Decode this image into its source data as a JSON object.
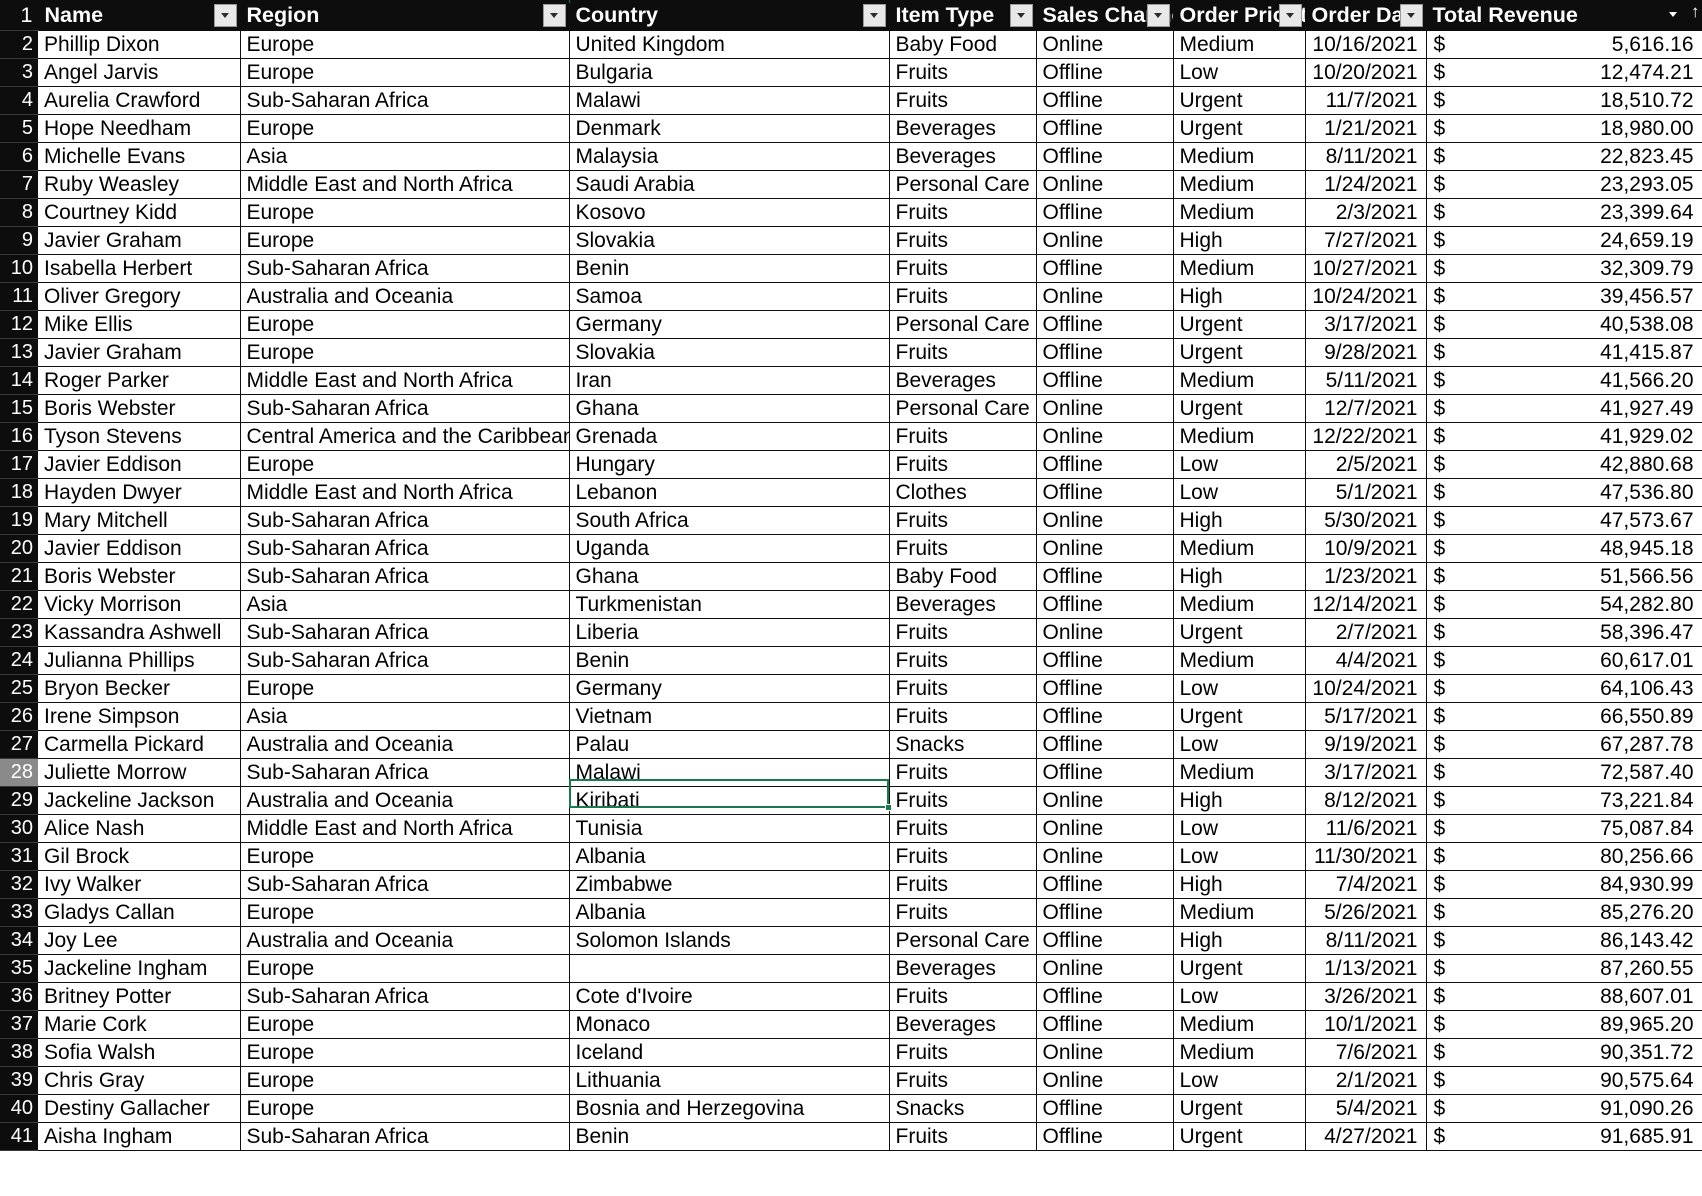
{
  "app": {
    "type": "spreadsheet",
    "accent_color": "#1b7a4b",
    "header_bg": "#0d0d0d",
    "header_fg": "#ffffff",
    "rowheader_selected_bg": "#8a8a8a"
  },
  "columns": [
    {
      "key": "name",
      "label": "Name",
      "filter_icon": "chevron-down-icon",
      "sorted": false,
      "align": "left"
    },
    {
      "key": "region",
      "label": "Region",
      "filter_icon": "chevron-down-icon",
      "sorted": false,
      "align": "left"
    },
    {
      "key": "country",
      "label": "Country",
      "filter_icon": "chevron-down-icon",
      "sorted": false,
      "align": "left"
    },
    {
      "key": "item",
      "label": "Item Type",
      "filter_icon": "chevron-down-icon",
      "sorted": false,
      "align": "left"
    },
    {
      "key": "channel",
      "label": "Sales Channe",
      "filter_icon": "chevron-down-icon",
      "sorted": false,
      "align": "left"
    },
    {
      "key": "prio",
      "label": "Order Priorit",
      "filter_icon": "chevron-down-icon",
      "sorted": false,
      "align": "left"
    },
    {
      "key": "date",
      "label": "Order Dat",
      "filter_icon": "chevron-down-icon",
      "sorted": false,
      "align": "left"
    },
    {
      "key": "revenue",
      "label": "Total Revenue",
      "filter_icon": "chevron-down-icon",
      "sorted": true,
      "sort_direction": "ascending",
      "sort_glyph": "↑",
      "align": "right"
    }
  ],
  "header_row_number": "1",
  "selection": {
    "row_number": "28",
    "column": "Country",
    "value": "Malawi"
  },
  "currency_symbol": "$",
  "rows": [
    {
      "n": "2",
      "name": "Phillip Dixon",
      "region": "Europe",
      "country": "United Kingdom",
      "item": "Baby Food",
      "channel": "Online",
      "prio": "Medium",
      "date": "10/16/2021",
      "revenue": "5,616.16"
    },
    {
      "n": "3",
      "name": "Angel Jarvis",
      "region": "Europe",
      "country": "Bulgaria",
      "item": "Fruits",
      "channel": "Offline",
      "prio": "Low",
      "date": "10/20/2021",
      "revenue": "12,474.21"
    },
    {
      "n": "4",
      "name": "Aurelia Crawford",
      "region": "Sub-Saharan Africa",
      "country": "Malawi",
      "item": "Fruits",
      "channel": "Offline",
      "prio": "Urgent",
      "date": "11/7/2021",
      "revenue": "18,510.72"
    },
    {
      "n": "5",
      "name": "Hope Needham",
      "region": "Europe",
      "country": "Denmark",
      "item": "Beverages",
      "channel": "Offline",
      "prio": "Urgent",
      "date": "1/21/2021",
      "revenue": "18,980.00"
    },
    {
      "n": "6",
      "name": "Michelle Evans",
      "region": "Asia",
      "country": "Malaysia",
      "item": "Beverages",
      "channel": "Offline",
      "prio": "Medium",
      "date": "8/11/2021",
      "revenue": "22,823.45"
    },
    {
      "n": "7",
      "name": "Ruby Weasley",
      "region": "Middle East and North Africa",
      "country": "Saudi Arabia",
      "item": "Personal Care",
      "channel": "Online",
      "prio": "Medium",
      "date": "1/24/2021",
      "revenue": "23,293.05"
    },
    {
      "n": "8",
      "name": "Courtney Kidd",
      "region": "Europe",
      "country": "Kosovo",
      "item": "Fruits",
      "channel": "Offline",
      "prio": "Medium",
      "date": "2/3/2021",
      "revenue": "23,399.64"
    },
    {
      "n": "9",
      "name": "Javier Graham",
      "region": "Europe",
      "country": "Slovakia",
      "item": "Fruits",
      "channel": "Online",
      "prio": "High",
      "date": "7/27/2021",
      "revenue": "24,659.19"
    },
    {
      "n": "10",
      "name": "Isabella Herbert",
      "region": "Sub-Saharan Africa",
      "country": "Benin",
      "item": "Fruits",
      "channel": "Offline",
      "prio": "Medium",
      "date": "10/27/2021",
      "revenue": "32,309.79"
    },
    {
      "n": "11",
      "name": "Oliver Gregory",
      "region": "Australia and Oceania",
      "country": "Samoa",
      "item": "Fruits",
      "channel": "Online",
      "prio": "High",
      "date": "10/24/2021",
      "revenue": "39,456.57"
    },
    {
      "n": "12",
      "name": "Mike Ellis",
      "region": "Europe",
      "country": "Germany",
      "item": "Personal Care",
      "channel": "Offline",
      "prio": "Urgent",
      "date": "3/17/2021",
      "revenue": "40,538.08"
    },
    {
      "n": "13",
      "name": "Javier Graham",
      "region": "Europe",
      "country": "Slovakia",
      "item": "Fruits",
      "channel": "Offline",
      "prio": "Urgent",
      "date": "9/28/2021",
      "revenue": "41,415.87"
    },
    {
      "n": "14",
      "name": "Roger Parker",
      "region": "Middle East and North Africa",
      "country": "Iran",
      "item": "Beverages",
      "channel": "Offline",
      "prio": "Medium",
      "date": "5/11/2021",
      "revenue": "41,566.20"
    },
    {
      "n": "15",
      "name": "Boris Webster",
      "region": "Sub-Saharan Africa",
      "country": "Ghana",
      "item": "Personal Care",
      "channel": "Online",
      "prio": "Urgent",
      "date": "12/7/2021",
      "revenue": "41,927.49"
    },
    {
      "n": "16",
      "name": "Tyson Stevens",
      "region": "Central America and the Caribbean",
      "country": "Grenada",
      "item": "Fruits",
      "channel": "Online",
      "prio": "Medium",
      "date": "12/22/2021",
      "revenue": "41,929.02"
    },
    {
      "n": "17",
      "name": "Javier Eddison",
      "region": "Europe",
      "country": "Hungary",
      "item": "Fruits",
      "channel": "Offline",
      "prio": "Low",
      "date": "2/5/2021",
      "revenue": "42,880.68"
    },
    {
      "n": "18",
      "name": "Hayden Dwyer",
      "region": "Middle East and North Africa",
      "country": "Lebanon",
      "item": "Clothes",
      "channel": "Offline",
      "prio": "Low",
      "date": "5/1/2021",
      "revenue": "47,536.80"
    },
    {
      "n": "19",
      "name": "Mary Mitchell",
      "region": "Sub-Saharan Africa",
      "country": "South Africa",
      "item": "Fruits",
      "channel": "Online",
      "prio": "High",
      "date": "5/30/2021",
      "revenue": "47,573.67"
    },
    {
      "n": "20",
      "name": "Javier Eddison",
      "region": "Sub-Saharan Africa",
      "country": "Uganda",
      "item": "Fruits",
      "channel": "Online",
      "prio": "Medium",
      "date": "10/9/2021",
      "revenue": "48,945.18"
    },
    {
      "n": "21",
      "name": "Boris Webster",
      "region": "Sub-Saharan Africa",
      "country": "Ghana",
      "item": "Baby Food",
      "channel": "Offline",
      "prio": "High",
      "date": "1/23/2021",
      "revenue": "51,566.56"
    },
    {
      "n": "22",
      "name": "Vicky Morrison",
      "region": "Asia",
      "country": "Turkmenistan",
      "item": "Beverages",
      "channel": "Offline",
      "prio": "Medium",
      "date": "12/14/2021",
      "revenue": "54,282.80"
    },
    {
      "n": "23",
      "name": "Kassandra Ashwell",
      "region": "Sub-Saharan Africa",
      "country": "Liberia",
      "item": "Fruits",
      "channel": "Online",
      "prio": "Urgent",
      "date": "2/7/2021",
      "revenue": "58,396.47"
    },
    {
      "n": "24",
      "name": "Julianna Phillips",
      "region": "Sub-Saharan Africa",
      "country": "Benin",
      "item": "Fruits",
      "channel": "Offline",
      "prio": "Medium",
      "date": "4/4/2021",
      "revenue": "60,617.01"
    },
    {
      "n": "25",
      "name": "Bryon Becker",
      "region": "Europe",
      "country": "Germany",
      "item": "Fruits",
      "channel": "Offline",
      "prio": "Low",
      "date": "10/24/2021",
      "revenue": "64,106.43"
    },
    {
      "n": "26",
      "name": "Irene Simpson",
      "region": "Asia",
      "country": "Vietnam",
      "item": "Fruits",
      "channel": "Offline",
      "prio": "Urgent",
      "date": "5/17/2021",
      "revenue": "66,550.89"
    },
    {
      "n": "27",
      "name": "Carmella Pickard",
      "region": "Australia and Oceania",
      "country": "Palau",
      "item": "Snacks",
      "channel": "Offline",
      "prio": "Low",
      "date": "9/19/2021",
      "revenue": "67,287.78"
    },
    {
      "n": "28",
      "name": "Juliette Morrow",
      "region": "Sub-Saharan Africa",
      "country": "Malawi",
      "item": "Fruits",
      "channel": "Offline",
      "prio": "Medium",
      "date": "3/17/2021",
      "revenue": "72,587.40"
    },
    {
      "n": "29",
      "name": "Jackeline Jackson",
      "region": "Australia and Oceania",
      "country": "Kiribati",
      "item": "Fruits",
      "channel": "Online",
      "prio": "High",
      "date": "8/12/2021",
      "revenue": "73,221.84"
    },
    {
      "n": "30",
      "name": "Alice Nash",
      "region": "Middle East and North Africa",
      "country": "Tunisia",
      "item": "Fruits",
      "channel": "Online",
      "prio": "Low",
      "date": "11/6/2021",
      "revenue": "75,087.84"
    },
    {
      "n": "31",
      "name": "Gil Brock",
      "region": "Europe",
      "country": "Albania",
      "item": "Fruits",
      "channel": "Online",
      "prio": "Low",
      "date": "11/30/2021",
      "revenue": "80,256.66"
    },
    {
      "n": "32",
      "name": "Ivy Walker",
      "region": "Sub-Saharan Africa",
      "country": "Zimbabwe",
      "item": "Fruits",
      "channel": "Offline",
      "prio": "High",
      "date": "7/4/2021",
      "revenue": "84,930.99"
    },
    {
      "n": "33",
      "name": "Gladys Callan",
      "region": "Europe",
      "country": "Albania",
      "item": "Fruits",
      "channel": "Offline",
      "prio": "Medium",
      "date": "5/26/2021",
      "revenue": "85,276.20"
    },
    {
      "n": "34",
      "name": "Joy Lee",
      "region": "Australia and Oceania",
      "country": "Solomon Islands",
      "item": "Personal Care",
      "channel": "Offline",
      "prio": "High",
      "date": "8/11/2021",
      "revenue": "86,143.42"
    },
    {
      "n": "35",
      "name": "Jackeline Ingham",
      "region": "Europe",
      "country": "",
      "item": "Beverages",
      "channel": "Online",
      "prio": "Urgent",
      "date": "1/13/2021",
      "revenue": "87,260.55"
    },
    {
      "n": "36",
      "name": "Britney Potter",
      "region": "Sub-Saharan Africa",
      "country": "Cote d'Ivoire",
      "item": "Fruits",
      "channel": "Offline",
      "prio": "Low",
      "date": "3/26/2021",
      "revenue": "88,607.01"
    },
    {
      "n": "37",
      "name": "Marie Cork",
      "region": "Europe",
      "country": "Monaco",
      "item": "Beverages",
      "channel": "Offline",
      "prio": "Medium",
      "date": "10/1/2021",
      "revenue": "89,965.20"
    },
    {
      "n": "38",
      "name": "Sofia Walsh",
      "region": "Europe",
      "country": "Iceland",
      "item": "Fruits",
      "channel": "Online",
      "prio": "Medium",
      "date": "7/6/2021",
      "revenue": "90,351.72"
    },
    {
      "n": "39",
      "name": "Chris Gray",
      "region": "Europe",
      "country": "Lithuania",
      "item": "Fruits",
      "channel": "Online",
      "prio": "Low",
      "date": "2/1/2021",
      "revenue": "90,575.64"
    },
    {
      "n": "40",
      "name": "Destiny Gallacher",
      "region": "Europe",
      "country": "Bosnia and Herzegovina",
      "item": "Snacks",
      "channel": "Offline",
      "prio": "Urgent",
      "date": "5/4/2021",
      "revenue": "91,090.26"
    },
    {
      "n": "41",
      "name": "Aisha Ingham",
      "region": "Sub-Saharan Africa",
      "country": "Benin",
      "item": "Fruits",
      "channel": "Offline",
      "prio": "Urgent",
      "date": "4/27/2021",
      "revenue": "91,685.91"
    }
  ]
}
